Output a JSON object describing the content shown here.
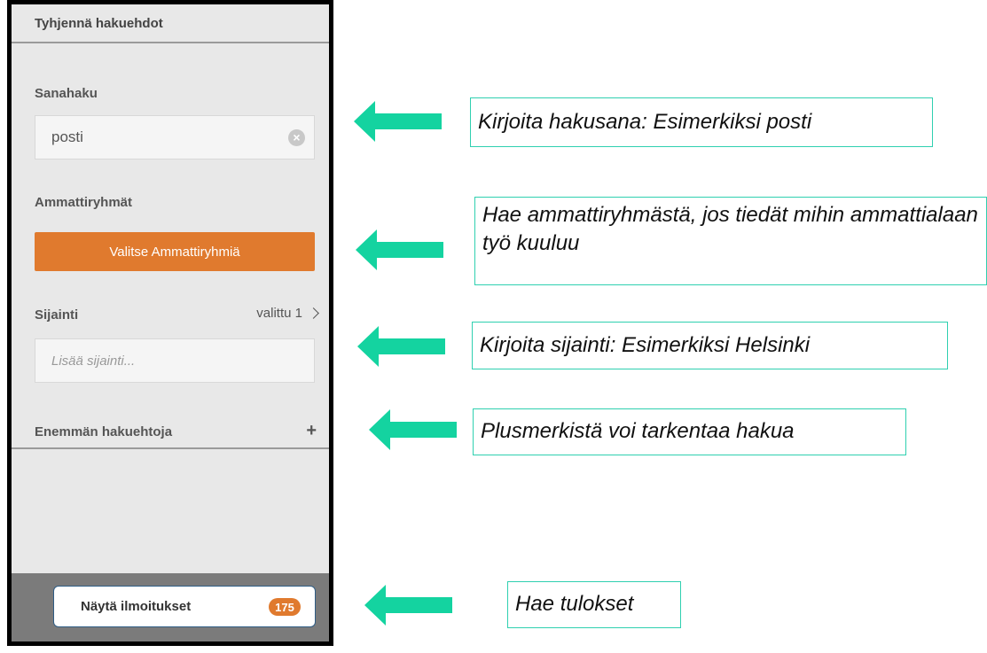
{
  "panel": {
    "clear_label": "Tyhjennä hakuehdot",
    "keyword": {
      "label": "Sanahaku",
      "value": "posti",
      "clear_glyph": "×"
    },
    "occupation": {
      "label": "Ammattiryhmät",
      "button_label": "Valitse Ammattiryhmiä"
    },
    "location": {
      "label": "Sijainti",
      "selected_text": "valittu 1",
      "placeholder": "Lisää sijainti..."
    },
    "more": {
      "label": "Enemmän hakuehtoja",
      "glyph": "+"
    },
    "footer": {
      "button_label": "Näytä ilmoitukset",
      "count": "175"
    }
  },
  "annotations": {
    "keyword": "Kirjoita hakusana: Esimerkiksi posti",
    "occupation": "Hae ammattiryhmästä, jos tiedät mihin ammattialaan työ kuuluu",
    "location": "Kirjoita sijainti: Esimerkiksi Helsinki",
    "more": "Plusmerkistä voi tarkentaa hakua",
    "results": "Hae tulokset"
  },
  "colors": {
    "accent_orange": "#e07a2e",
    "arrow_green": "#14d3a0",
    "callout_border": "#2fd0b0",
    "footer_gray": "#7b7b7b"
  },
  "icons": {
    "arrow": "arrow-left-icon",
    "chevron": "chevron-right-icon",
    "clear": "clear-circle-icon"
  }
}
